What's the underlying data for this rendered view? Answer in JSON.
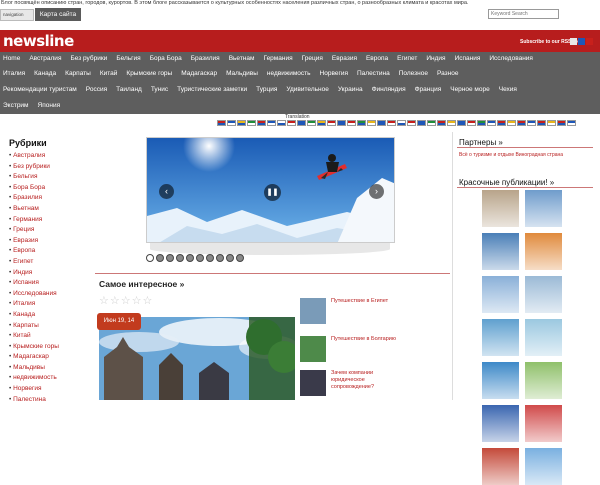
{
  "topbar": {
    "tagline": "Блог посвящён описанию стран, городов, курортов. В этом блоге рассказывается о культурных особенностях населения различных стран, о разнообразных климата и красотах мира.",
    "navigation_label": "navigation",
    "map_button": "Карта сайта",
    "search_placeholder": "Keyword Search"
  },
  "header": {
    "logo": "newsline",
    "rss_text": "Subscribe to our RSS feed",
    "rss_colors": [
      "#e8e8e8",
      "#1e57b8",
      "#c8201c"
    ]
  },
  "nav": {
    "row1": [
      "Home",
      "Австралия",
      "Без рубрики",
      "Бельгия",
      "Бора Бора",
      "Бразилия",
      "Вьетнам",
      "Германия",
      "Греция",
      "Евразия",
      "Европа",
      "Египет",
      "Индия",
      "Испания",
      "Исследования"
    ],
    "row2": [
      "Италия",
      "Канада",
      "Карпаты",
      "Китай",
      "Крымские горы",
      "Мадагаскар",
      "Мальдивы",
      "недвижимость",
      "Норвегия",
      "Палестина",
      "Полезное",
      "Разное"
    ],
    "row3": [
      "Рекомендации туристам",
      "Россия",
      "Таиланд",
      "Тунис",
      "Туристические заметки",
      "Турция",
      "Удивительное",
      "Украина",
      "Финляндия",
      "Франция",
      "Черное море",
      "Чехия"
    ],
    "row4": [
      "Экстрим",
      "Япония"
    ]
  },
  "translation": {
    "label": "Translation",
    "flag_colors": [
      "#c8201c",
      "#1e57b8",
      "#e8b619",
      "#1f8f3a",
      "#c8201c",
      "#1e57b8",
      "#ffffff",
      "#c8201c",
      "#1e57b8",
      "#1f8f3a",
      "#e8b619",
      "#c8201c",
      "#1e57b8",
      "#c8201c",
      "#1f8f3a",
      "#e8b619",
      "#1e57b8",
      "#c8201c",
      "#ffffff",
      "#c8201c",
      "#1e57b8",
      "#1f8f3a",
      "#c8201c",
      "#e8b619",
      "#1e57b8",
      "#c8201c",
      "#1f8f3a",
      "#1e57b8",
      "#c8201c",
      "#e8b619",
      "#c8201c",
      "#1e57b8",
      "#c8201c",
      "#e8b619",
      "#c8201c",
      "#1e57b8"
    ]
  },
  "rubrics": {
    "title": "Рубрики",
    "items": [
      "Австралия",
      "Без рубрики",
      "Бельгия",
      "Бора Бора",
      "Бразилия",
      "Вьетнам",
      "Германия",
      "Греция",
      "Евразия",
      "Европа",
      "Египет",
      "Индия",
      "Испания",
      "Исследования",
      "Италия",
      "Канада",
      "Карпаты",
      "Китай",
      "Крымские горы",
      "Мадагаскар",
      "Мальдивы",
      "недвижимость",
      "Норвегия",
      "Палестина"
    ]
  },
  "main": {
    "slider_dots": 10,
    "slider_active_dot": 0,
    "interesting_title": "Самое интересное »",
    "stars_total": 5,
    "stars_filled": 0,
    "post_date": "Июн 19, 14",
    "thumbs": [
      {
        "title": "Путешествие в Египет",
        "color": "#7a9bb8"
      },
      {
        "title": "Путешествие в Болгарию",
        "color": "#4e8a4a"
      },
      {
        "title": "Зачем компании юридическое сопровождение?",
        "color": "#3a3a4a"
      }
    ]
  },
  "right": {
    "partners_title": "Партнеры »",
    "partner_links": "Всё о туризме и отдыхе Виноградная страна",
    "beautiful_title": "Красочные публикации! »",
    "gallery_colors": [
      "#b8a48a",
      "#6f9ccb",
      "#4a7fb7",
      "#e08a3c",
      "#8ab0d8",
      "#9bbad6",
      "#5fa0cf",
      "#9bc8e0",
      "#3d89c8",
      "#8fc06a",
      "#3a66b0",
      "#d04a4a",
      "#c44a3a",
      "#7ab0e0"
    ]
  }
}
